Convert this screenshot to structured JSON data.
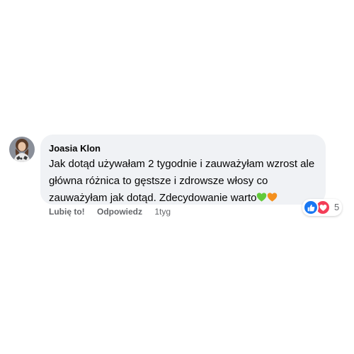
{
  "comment": {
    "author": "Joasia Klon",
    "text": "Jak dotąd używałam 2 tygodnie i zauważyłam wzrost ale\ngłówna różnica to gęstsze i zdrowsze włosy co\nzauważyłam jak dotąd. Zdecydowanie warto",
    "emojis": [
      "green-heart-icon",
      "orange-heart-icon"
    ]
  },
  "actions": {
    "like_label": "Lubię to!",
    "reply_label": "Odpowiedz",
    "timestamp": "1tyg"
  },
  "reactions": {
    "types": [
      "like-icon",
      "love-icon"
    ],
    "count": "5"
  },
  "colors": {
    "bubble": "#f0f2f5",
    "text": "#050505",
    "secondary": "#65676b",
    "like": "#1877f2",
    "love": "#f33e58",
    "green_heart": "#63c93a",
    "orange_heart": "#f4901e"
  }
}
